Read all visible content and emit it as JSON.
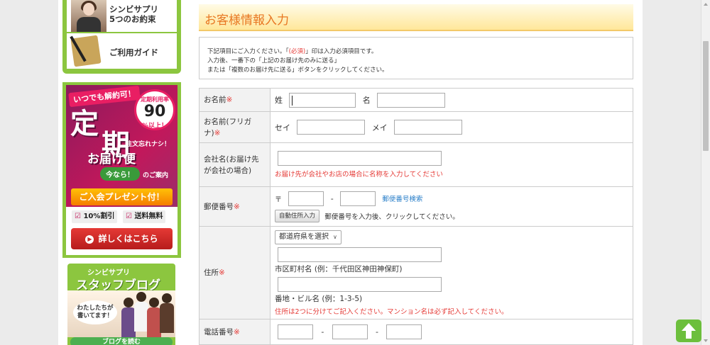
{
  "sidebar": {
    "nav": [
      {
        "label_1": "シンビサプリ",
        "label_2": "5つのお約束"
      },
      {
        "label": "ご利用ガイド"
      }
    ],
    "ad": {
      "banner": "いつでも解約可！",
      "big_1": "定",
      "big_2": "期",
      "circle_1": "定期利用率",
      "circle_2": "90",
      "circle_3": "%以上！",
      "sub": "注文忘れナシ！",
      "todoke": "お届け便",
      "now": "今なら！",
      "annai": "のご案内",
      "present": "ご入会プレゼント付！",
      "chk1": "10%割引",
      "chk2": "送料無料",
      "detail": "詳しくはこちら"
    },
    "blog": {
      "t1": "シンビサプリ",
      "t2": "スタッフブログ",
      "bubble_1": "わたしたちが",
      "bubble_2": "書いてます！",
      "read": "ブログを読む"
    }
  },
  "main": {
    "title": "お客様情報入力",
    "notice": {
      "line1_pre": "下記項目にご入力ください。「",
      "line1_req": "(必須)",
      "line1_post": "」印は入力必須項目です。",
      "line2": "入力後、一番下の「上記のお届け先のみに送る」",
      "line3": "または「複数のお届け先に送る」ボタンをクリックしてください。"
    },
    "rows": {
      "name": {
        "label": "お名前",
        "sei": "姓",
        "mei": "名"
      },
      "kana": {
        "label": "お名前(フリガナ)",
        "sei": "セイ",
        "mei": "メイ"
      },
      "company": {
        "label": "会社名(お届け先が会社の場合)",
        "hint": "お届け先が会社やお店の場合に名称を入力してください"
      },
      "zip": {
        "label": "郵便番号",
        "mark": "〒",
        "dash": "-",
        "search": "郵便番号検索",
        "auto_btn": "自動住所入力",
        "auto_hint": "郵便番号を入力後、クリックしてください。"
      },
      "address": {
        "label": "住所",
        "pref_select": "都道府県を選択",
        "city_caption": "市区町村名 (例：千代田区神田神保町)",
        "street_caption": "番地・ビル名 (例：1-3-5)",
        "hint": "住所は2つに分けてご記入ください。マンション名は必ず記入してください。"
      },
      "tel": {
        "label": "電話番号",
        "dash1": "-",
        "dash2": "-"
      }
    },
    "required_mark": "※"
  },
  "colors": {
    "accent_green": "#8cc63f",
    "title_orange": "#e87722",
    "required_red": "#e53935",
    "link_blue": "#2a7fc9"
  }
}
